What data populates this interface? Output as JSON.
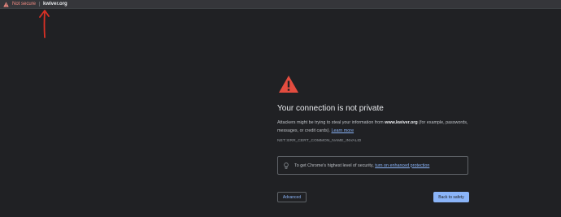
{
  "address_bar": {
    "security_label": "Not secure",
    "url": "kwiver.org",
    "security_icon": "warning-triangle-icon"
  },
  "annotation": {
    "icon": "red-arrow-icon",
    "color": "#d93025"
  },
  "interstitial": {
    "icon": "warning-triangle-icon",
    "icon_color": "#e34c3f",
    "heading": "Your connection is not private",
    "description_pre": "Attackers might be trying to steal your information from ",
    "domain": "www.kwiver.org",
    "description_post": " (for example, passwords, messages, or credit cards). ",
    "learn_more": "Learn more",
    "error_code": "NET::ERR_CERT_COMMON_NAME_INVALID",
    "tip_icon": "lightbulb-icon",
    "tip_text": "To get Chrome's highest level of security, ",
    "tip_link": "turn on enhanced protection",
    "advanced_label": "Advanced",
    "back_label": "Back to safety"
  },
  "colors": {
    "background": "#202124",
    "link": "#8ab4f8",
    "primary_button": "#8ab4f8",
    "warning_text": "#f28b82"
  }
}
